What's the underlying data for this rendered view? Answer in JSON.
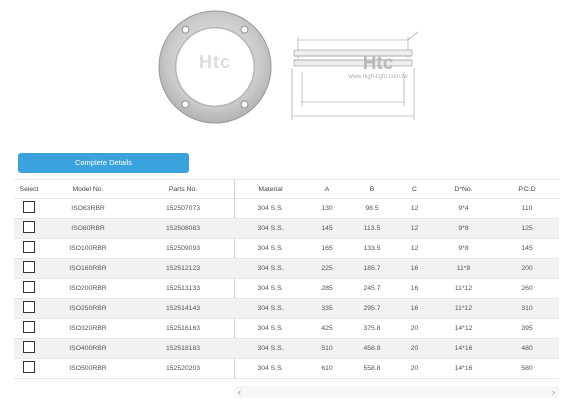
{
  "product": {
    "photo_watermark": "Htc",
    "logo_text": "Htc",
    "logo_sub": "www.high-light.com.tw"
  },
  "details_button": "Complete Details",
  "table": {
    "headers": {
      "select": "Select",
      "model": "Model No.",
      "parts": "Parts No.",
      "material": "Material",
      "a": "A",
      "b": "B",
      "c": "C",
      "d": "D*No.",
      "pcd": "P.C.D"
    },
    "rows": [
      {
        "model": "ISO63RBR",
        "parts": "152507073",
        "material": "304 S.S.",
        "a": "130",
        "b": "98.5",
        "c": "12",
        "d": "9*4",
        "pcd": "110"
      },
      {
        "model": "ISO80RBR",
        "parts": "152508083",
        "material": "304 S.S.",
        "a": "145",
        "b": "113.5",
        "c": "12",
        "d": "9*8",
        "pcd": "125"
      },
      {
        "model": "ISO100RBR",
        "parts": "152509093",
        "material": "304 S.S.",
        "a": "165",
        "b": "133.5",
        "c": "12",
        "d": "9*8",
        "pcd": "145"
      },
      {
        "model": "ISO160RBR",
        "parts": "152512123",
        "material": "304 S.S.",
        "a": "225",
        "b": "185.7",
        "c": "16",
        "d": "11*8",
        "pcd": "200"
      },
      {
        "model": "ISO200RBR",
        "parts": "152513133",
        "material": "304 S.S.",
        "a": "285",
        "b": "245.7",
        "c": "16",
        "d": "11*12",
        "pcd": "260"
      },
      {
        "model": "ISO250RBR",
        "parts": "152514143",
        "material": "304 S.S.",
        "a": "335",
        "b": "295.7",
        "c": "16",
        "d": "11*12",
        "pcd": "310"
      },
      {
        "model": "ISO320RBR",
        "parts": "152516163",
        "material": "304 S.S.",
        "a": "425",
        "b": "375.8",
        "c": "20",
        "d": "14*12",
        "pcd": "395"
      },
      {
        "model": "ISO400RBR",
        "parts": "152518183",
        "material": "304 S.S.",
        "a": "510",
        "b": "458.8",
        "c": "20",
        "d": "14*16",
        "pcd": "480"
      },
      {
        "model": "ISO500RBR",
        "parts": "152520203",
        "material": "304 S.S.",
        "a": "610",
        "b": "558.8",
        "c": "20",
        "d": "14*16",
        "pcd": "580"
      }
    ]
  },
  "scroll": {
    "left_arrow": "‹",
    "right_arrow": "›"
  }
}
